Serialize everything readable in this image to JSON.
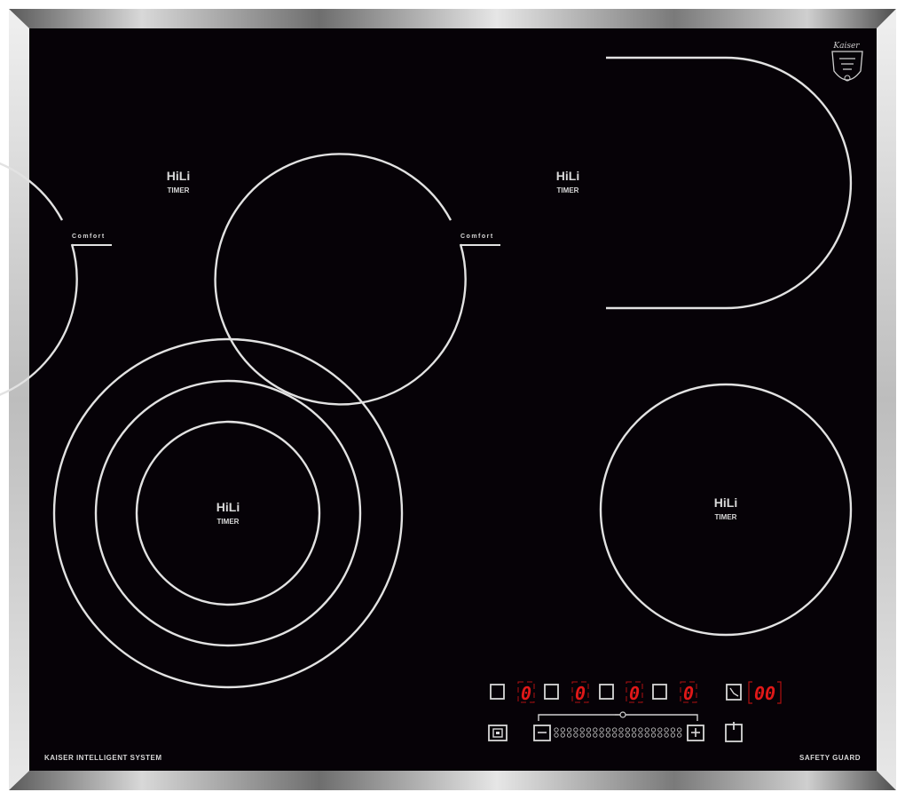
{
  "zones": [
    {
      "id": "front-left",
      "brand": "HiLi",
      "label": "TIMER",
      "comfort": "Comfort"
    },
    {
      "id": "rear-right",
      "brand": "HiLi",
      "label": "TIMER",
      "comfort": "Comfort"
    },
    {
      "id": "rear-left-triple",
      "brand": "HiLi",
      "label": "TIMER"
    },
    {
      "id": "front-right",
      "brand": "HiLi",
      "label": "TIMER"
    }
  ],
  "controls": {
    "zone_displays": [
      "0",
      "0",
      "0",
      "0"
    ],
    "timer_display": "00"
  },
  "footer": {
    "left": "KAISER INTELLIGENT SYSTEM",
    "right": "SAFETY GUARD"
  },
  "logo": {
    "text": "Kaiser"
  },
  "colors": {
    "glass": "#060207",
    "led": "#e01818",
    "print": "#e2e2e2",
    "frame": "#9a9a9a"
  },
  "icons": {
    "timer": "clock-icon",
    "lock": "lock-icon",
    "power": "power-icon",
    "minus": "minus-icon",
    "plus": "plus-icon",
    "slider": "slider-dots-icon"
  }
}
